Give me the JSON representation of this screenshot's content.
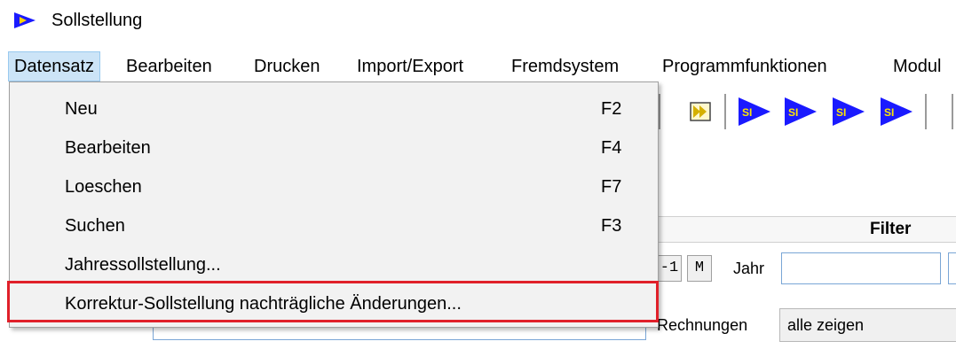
{
  "window": {
    "title": "Sollstellung",
    "icon": "app-arrow-icon"
  },
  "menubar": {
    "items": [
      "Datensatz",
      "Bearbeiten",
      "Drucken",
      "Import/Export",
      "Fremdsystem",
      "Programmfunktionen",
      "Modul"
    ],
    "active": "Datensatz"
  },
  "dropdown": {
    "items": [
      {
        "label": "Neu",
        "shortcut": "F2"
      },
      {
        "label": "Bearbeiten",
        "shortcut": "F4"
      },
      {
        "label": "Loeschen",
        "shortcut": "F7"
      },
      {
        "label": "Suchen",
        "shortcut": "F3"
      },
      {
        "label": "Jahressollstellung...",
        "shortcut": ""
      },
      {
        "label": "Korrektur-Sollstellung nachträgliche Änderungen...",
        "shortcut": ""
      }
    ],
    "highlighted_index": 5,
    "highlight_color": "#e0202a"
  },
  "toolbar": {
    "buttons": [
      "next-record-icon",
      "si-arrow-icon",
      "si-arrow-icon",
      "si-arrow-icon",
      "si-arrow-icon"
    ],
    "si_label": "SI",
    "icon_color": "#1a1aff"
  },
  "form": {
    "filter_header": "Filter",
    "btn_m1": "-1",
    "btn_m": "M",
    "jahr_label": "Jahr",
    "jahr_value": "",
    "rechnungen_label": "Rechnungen",
    "rechnungen_select": "alle zeigen"
  },
  "colors": {
    "menu_active_bg": "#cce4f7",
    "dropdown_bg": "#f2f2f2"
  }
}
